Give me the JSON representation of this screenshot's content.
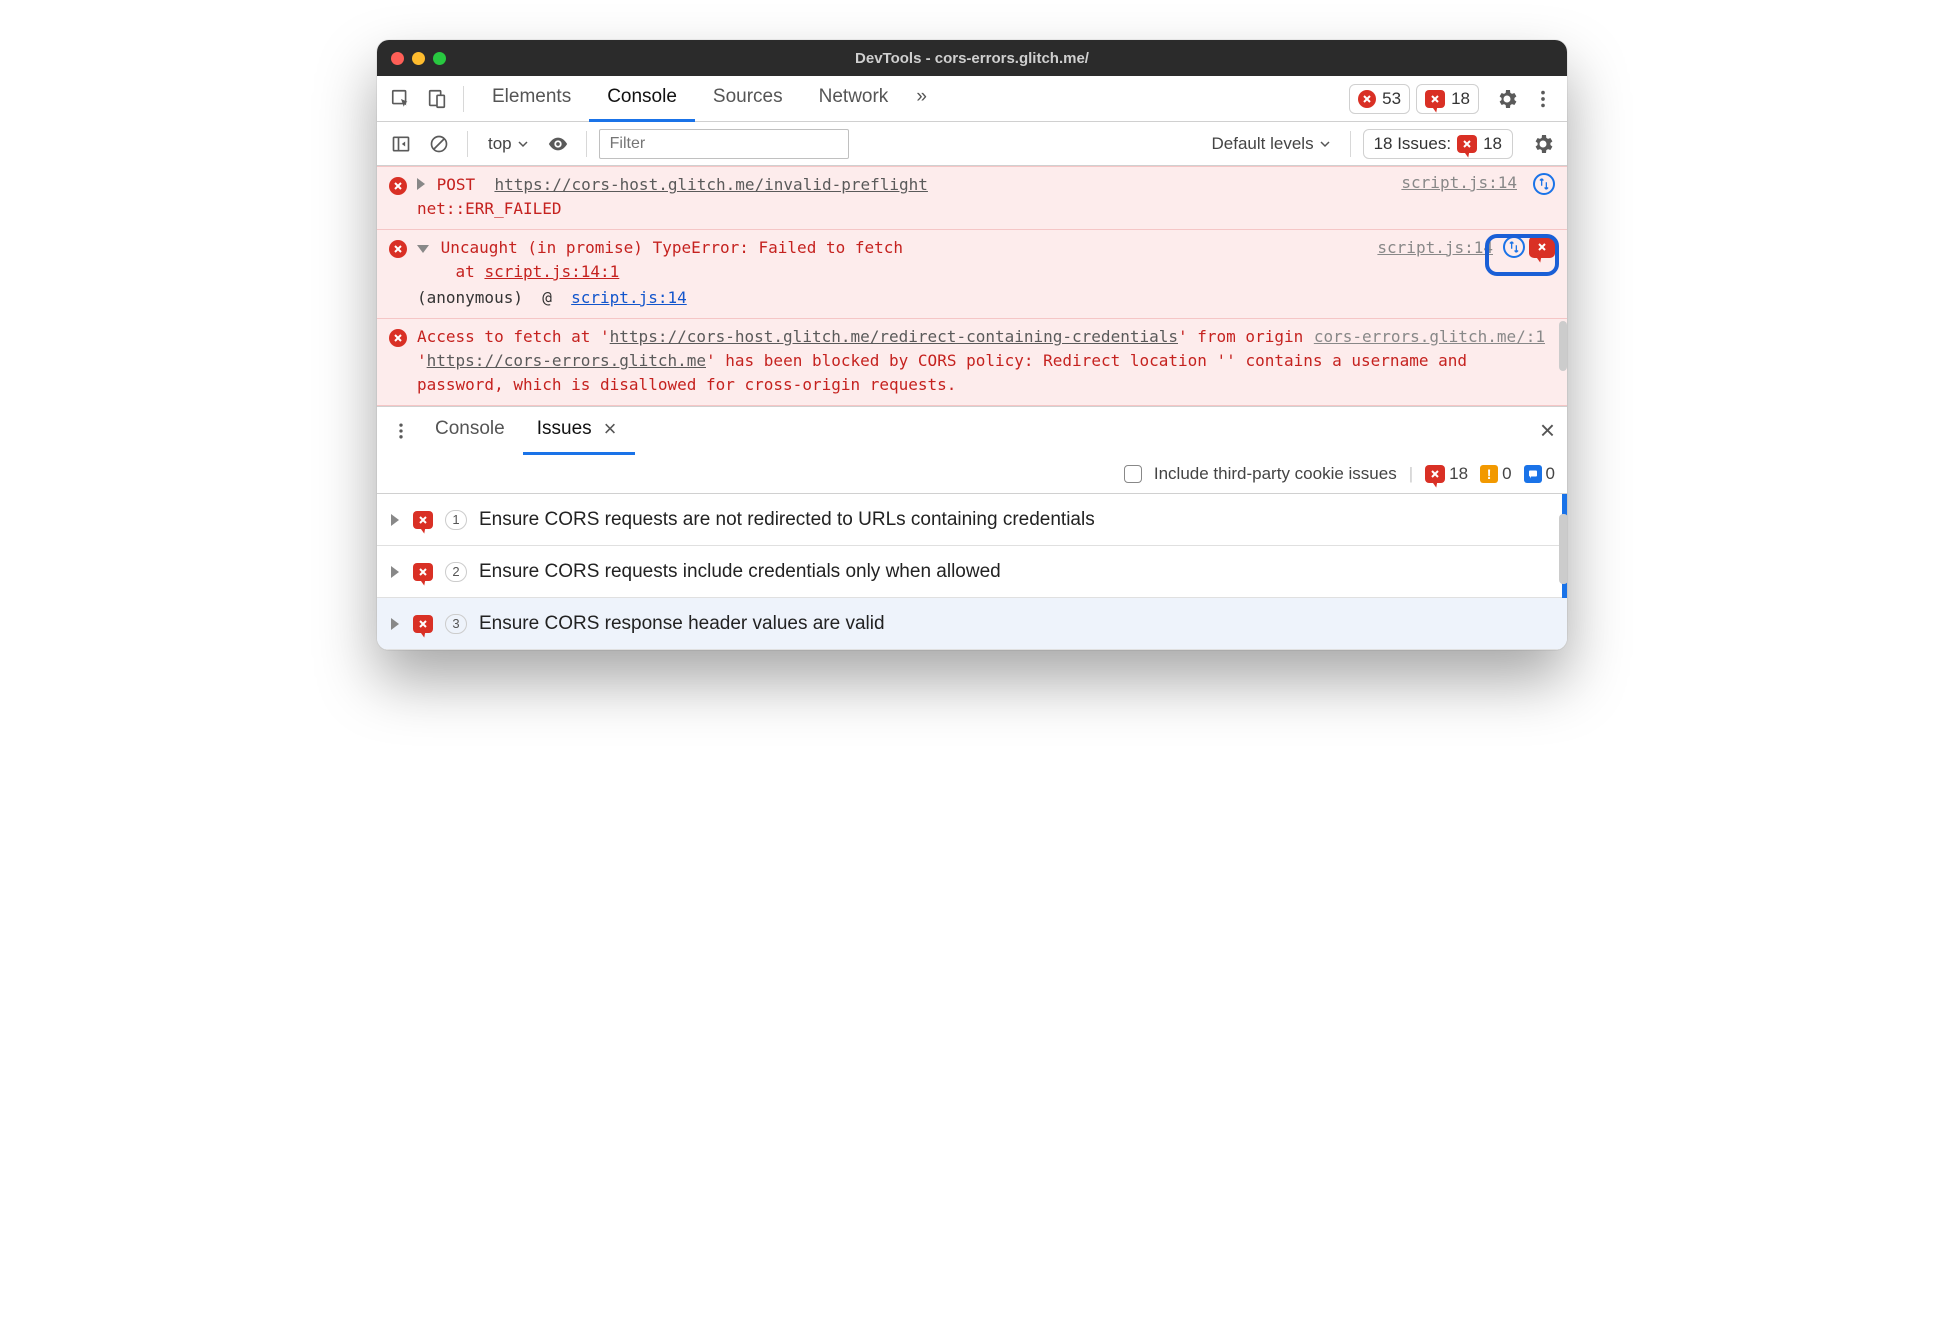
{
  "window": {
    "title": "DevTools - cors-errors.glitch.me/"
  },
  "tabs": {
    "items": [
      "Elements",
      "Console",
      "Sources",
      "Network"
    ],
    "active": "Console",
    "more": "»"
  },
  "badges": {
    "error_count": "53",
    "issue_count": "18"
  },
  "toolbar": {
    "context": "top",
    "filter_placeholder": "Filter",
    "levels": "Default levels",
    "issues_label": "18 Issues:",
    "issues_badge": "18"
  },
  "console": {
    "messages": [
      {
        "method": "POST",
        "url": "https://cors-host.glitch.me/invalid-preflight",
        "status": "net::ERR_FAILED",
        "source": "script.js:14"
      },
      {
        "headline": "Uncaught (in promise) TypeError: Failed to fetch",
        "stack_at": "at ",
        "stack_loc": "script.js:14:1",
        "anon_label": "(anonymous)",
        "anon_at": "@",
        "anon_loc": "script.js:14",
        "source": "script.js:14"
      },
      {
        "pre": "Access to fetch at '",
        "url1": "https://cors-host.glitch.me/redirect-containing-credentials",
        "mid1": "' from origin '",
        "url2": "https://cors-errors.glitch.me",
        "mid2": "' has been blocked by CORS policy: Redirect location '' contains a username and password, which is disallowed for cross-origin requests.",
        "source": "cors-errors.glitch.me/:1"
      }
    ]
  },
  "drawer": {
    "tabs": [
      "Console",
      "Issues"
    ],
    "active": "Issues"
  },
  "issues_toolbar": {
    "checkbox_label": "Include third-party cookie issues",
    "err": "18",
    "warn": "0",
    "info": "0"
  },
  "issues": [
    {
      "count": "1",
      "title": "Ensure CORS requests are not redirected to URLs containing credentials"
    },
    {
      "count": "2",
      "title": "Ensure CORS requests include credentials only when allowed"
    },
    {
      "count": "3",
      "title": "Ensure CORS response header values are valid"
    }
  ]
}
